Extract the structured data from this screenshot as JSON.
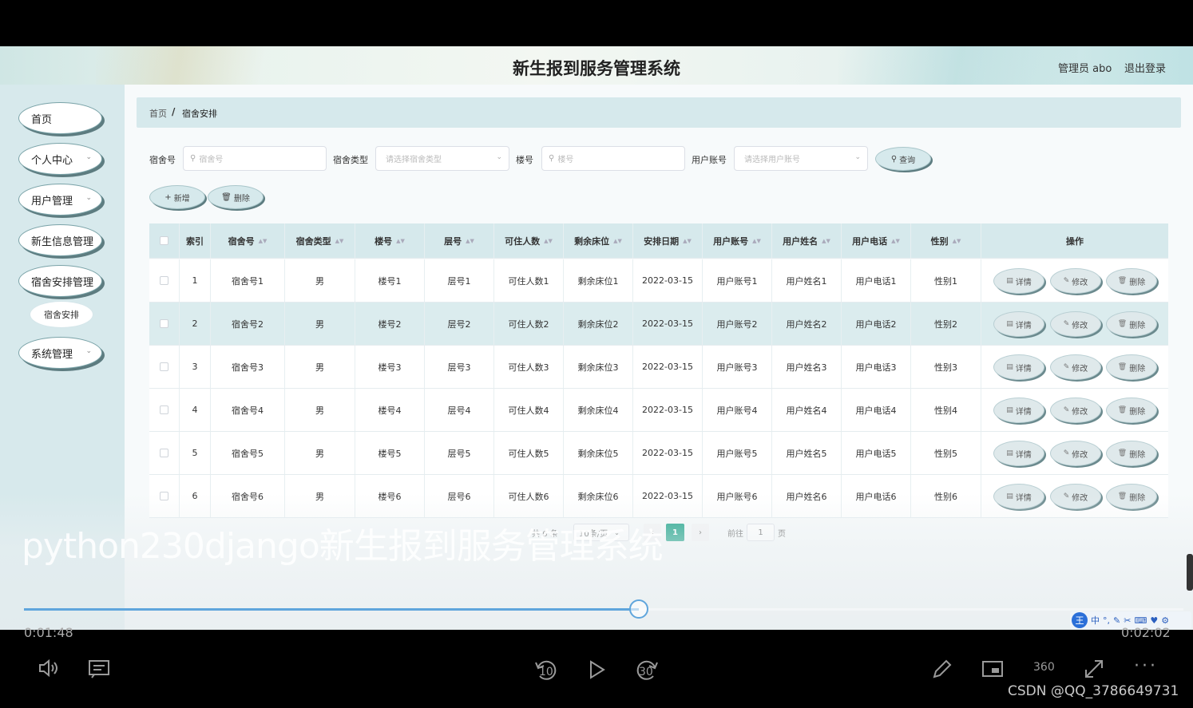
{
  "app": {
    "title": "新生报到服务管理系统",
    "admin_label": "管理员 abo",
    "logout_label": "退出登录"
  },
  "sidebar": {
    "items": [
      {
        "label": "首页",
        "has_children": false
      },
      {
        "label": "个人中心",
        "has_children": true
      },
      {
        "label": "用户管理",
        "has_children": true
      },
      {
        "label": "新生信息管理",
        "has_children": true
      },
      {
        "label": "宿舍安排管理",
        "has_children": true
      },
      {
        "label": "系统管理",
        "has_children": true
      }
    ],
    "sub_item": "宿舍安排"
  },
  "breadcrumb": {
    "home": "首页",
    "separator": "/",
    "current": "宿舍安排"
  },
  "filters": {
    "dorm_no_label": "宿舍号",
    "dorm_no_placeholder": "宿舍号",
    "dorm_type_label": "宿舍类型",
    "dorm_type_placeholder": "请选择宿舍类型",
    "building_label": "楼号",
    "building_placeholder": "楼号",
    "account_label": "用户账号",
    "account_placeholder": "请选择用户账号",
    "query_button": "查询"
  },
  "toolbar": {
    "add_button": "新增",
    "delete_button": "删除"
  },
  "table": {
    "columns": [
      "索引",
      "宿舍号",
      "宿舍类型",
      "楼号",
      "层号",
      "可住人数",
      "剩余床位",
      "安排日期",
      "用户账号",
      "用户姓名",
      "用户电话",
      "性别",
      "操作"
    ],
    "rows": [
      {
        "index": "1",
        "dorm": "宿舍号1",
        "type": "男",
        "building": "楼号1",
        "floor": "层号1",
        "capacity": "可住人数1",
        "beds": "剩余床位1",
        "date": "2022-03-15",
        "account": "用户账号1",
        "name": "用户姓名1",
        "phone": "用户电话1",
        "gender": "性别1"
      },
      {
        "index": "2",
        "dorm": "宿舍号2",
        "type": "男",
        "building": "楼号2",
        "floor": "层号2",
        "capacity": "可住人数2",
        "beds": "剩余床位2",
        "date": "2022-03-15",
        "account": "用户账号2",
        "name": "用户姓名2",
        "phone": "用户电话2",
        "gender": "性别2"
      },
      {
        "index": "3",
        "dorm": "宿舍号3",
        "type": "男",
        "building": "楼号3",
        "floor": "层号3",
        "capacity": "可住人数3",
        "beds": "剩余床位3",
        "date": "2022-03-15",
        "account": "用户账号3",
        "name": "用户姓名3",
        "phone": "用户电话3",
        "gender": "性别3"
      },
      {
        "index": "4",
        "dorm": "宿舍号4",
        "type": "男",
        "building": "楼号4",
        "floor": "层号4",
        "capacity": "可住人数4",
        "beds": "剩余床位4",
        "date": "2022-03-15",
        "account": "用户账号4",
        "name": "用户姓名4",
        "phone": "用户电话4",
        "gender": "性别4"
      },
      {
        "index": "5",
        "dorm": "宿舍号5",
        "type": "男",
        "building": "楼号5",
        "floor": "层号5",
        "capacity": "可住人数5",
        "beds": "剩余床位5",
        "date": "2022-03-15",
        "account": "用户账号5",
        "name": "用户姓名5",
        "phone": "用户电话5",
        "gender": "性别5"
      },
      {
        "index": "6",
        "dorm": "宿舍号6",
        "type": "男",
        "building": "楼号6",
        "floor": "层号6",
        "capacity": "可住人数6",
        "beds": "剩余床位6",
        "date": "2022-03-15",
        "account": "用户账号6",
        "name": "用户姓名6",
        "phone": "用户电话6",
        "gender": "性别6"
      }
    ],
    "highlighted_row": 1,
    "actions": {
      "detail": "详情",
      "edit": "修改",
      "delete": "删除"
    }
  },
  "pagination": {
    "total": "共 6 条",
    "page_size": "10条/页",
    "current_page": "1",
    "goto_label": "前往",
    "goto_value": "1",
    "page_suffix": "页"
  },
  "video": {
    "watermark": "python230django新生报到服务管理系统",
    "current_time": "0:01:48",
    "total_time": "0:02:02",
    "progress": 0.5306,
    "rewind_label": "10",
    "forward_label": "30",
    "vr_label": "360",
    "credit": "CSDN @QQ_3786649731"
  },
  "ime": {
    "logo": "王",
    "mode": "中"
  },
  "colors": {
    "accent": "#16a085",
    "progress": "#5fa5dc",
    "header_bg": "#d6e9ec"
  },
  "icons": [
    "search-icon",
    "plus-icon",
    "trash-icon",
    "detail-icon",
    "edit-icon",
    "chevron-down-icon",
    "volume-icon",
    "danmaku-icon",
    "rewind-icon",
    "play-icon",
    "forward-icon",
    "pencil-icon",
    "pip-icon",
    "vr360-icon",
    "fullscreen-icon",
    "more-icon"
  ]
}
